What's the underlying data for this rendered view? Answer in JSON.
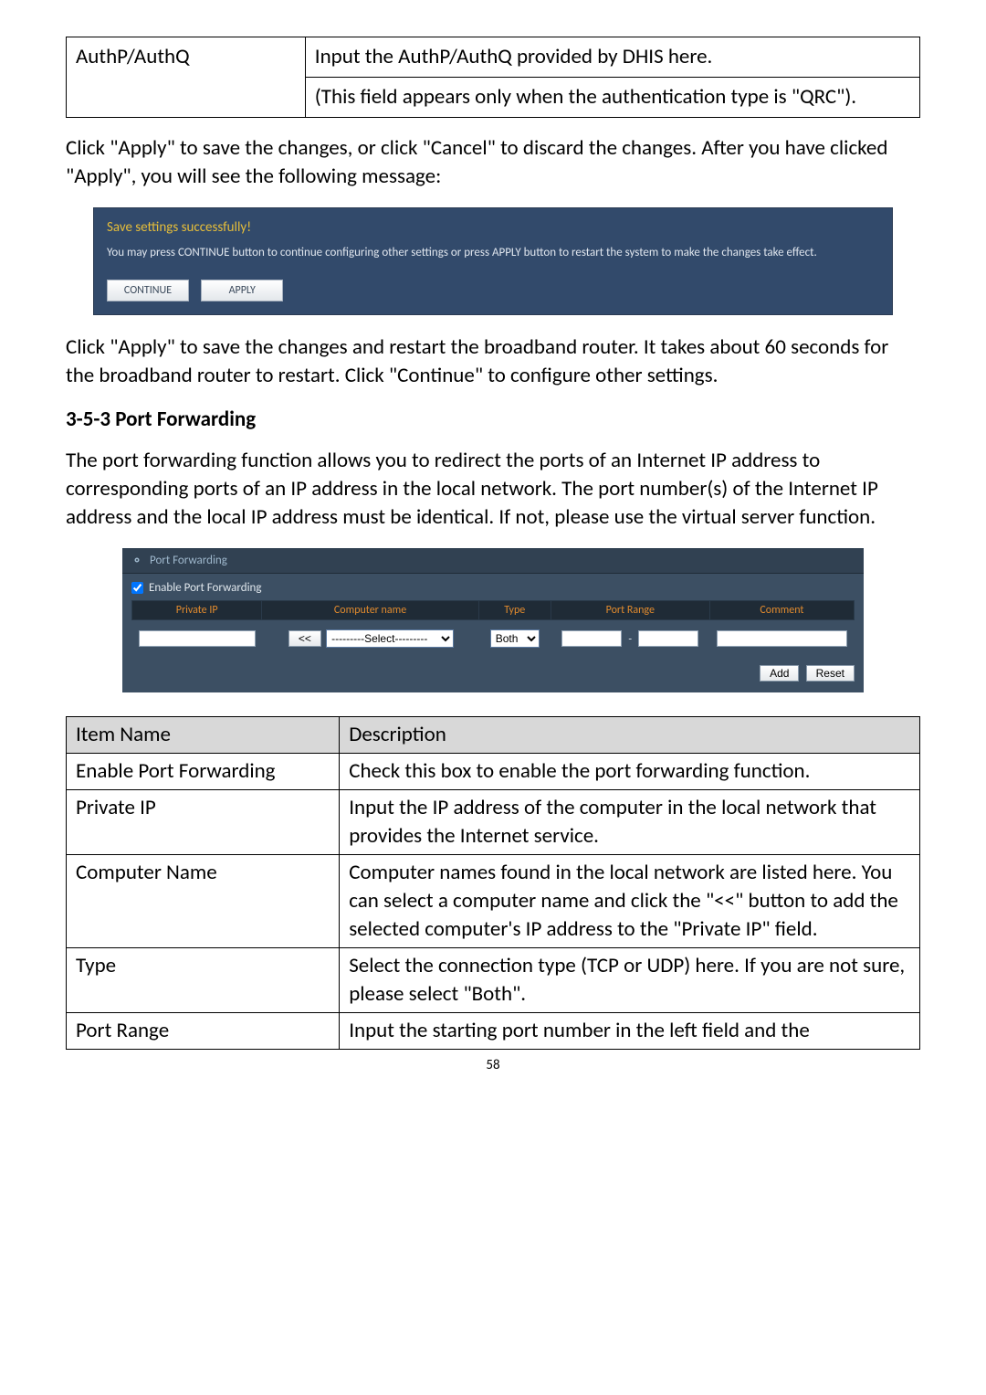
{
  "top_table": {
    "key": "AuthP/AuthQ",
    "desc_line1": "Input the AuthP/AuthQ provided by DHIS here.",
    "desc_line2": "(This field appears only when the authentication type is \"QRC\")."
  },
  "para1": "Click \"Apply\" to save the changes, or click \"Cancel\" to discard the changes. After you have clicked \"Apply\", you will see the following message:",
  "save_panel": {
    "title": "Save settings successfully!",
    "message": "You may press CONTINUE button to continue configuring other settings or press APPLY button to restart the system to make the changes take effect.",
    "continue_label": "CONTINUE",
    "apply_label": "APPLY"
  },
  "para2": "Click \"Apply\" to save the changes and restart the broadband router. It takes about 60 seconds for the broadband router to restart. Click \"Continue\" to configure other settings.",
  "section_heading": "3-5-3 Port Forwarding",
  "para3": "The port forwarding function allows you to redirect the ports of an Internet IP address to corresponding ports of an IP address in the local network. The port number(s) of the Internet IP address and the local IP address must be identical. If not, please use the virtual server function.",
  "pf_panel": {
    "title": "Port Forwarding",
    "enable_label": "Enable Port Forwarding",
    "enable_checked": true,
    "headers": {
      "private_ip": "Private IP",
      "computer_name": "Computer name",
      "type": "Type",
      "port_range": "Port Range",
      "comment": "Comment"
    },
    "row": {
      "copy_button_label": "<<",
      "select_placeholder": "---------Select---------",
      "type_value": "Both",
      "port_range_sep": "-"
    },
    "buttons": {
      "add_label": "Add",
      "reset_label": "Reset"
    }
  },
  "desc_table": {
    "header": {
      "c1": "Item Name",
      "c2": "Description"
    },
    "rows": [
      {
        "name": "Enable Port Forwarding",
        "desc": "Check this box to enable the port forwarding function."
      },
      {
        "name": "Private IP",
        "desc": "Input the IP address of the computer in the local network that provides the Internet service."
      },
      {
        "name": "Computer Name",
        "desc": "Computer names found in the local network are listed here. You can select a computer name and click the \"<<\" button to add the selected computer's IP address to the \"Private IP\" field."
      },
      {
        "name": "Type",
        "desc": "Select the connection type (TCP or UDP) here. If you are not sure, please select \"Both\"."
      },
      {
        "name": "Port Range",
        "desc": "Input the starting port number in the left field and the"
      }
    ]
  },
  "page_number": "58"
}
